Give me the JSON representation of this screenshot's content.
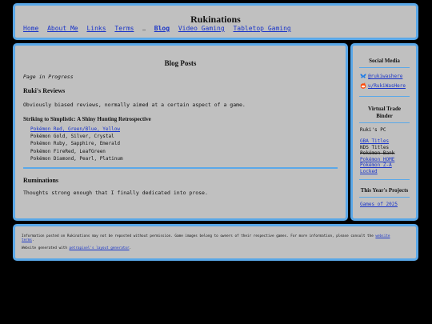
{
  "header": {
    "title": "Rukinations",
    "nav": [
      {
        "label": "Home"
      },
      {
        "label": "About Me"
      },
      {
        "label": "Links"
      },
      {
        "label": "Terms"
      },
      {
        "label": "Blog"
      },
      {
        "label": "Video Gaming"
      },
      {
        "label": "Tabletop Gaming"
      }
    ],
    "separator": "…"
  },
  "main": {
    "title": "Blog Posts",
    "progress_note": "Page in Progress",
    "section1": {
      "heading": "Ruki's Reviews",
      "description": "Obviously biased reviews, normally aimed at a certain aspect of a game.",
      "subheading": "Striking to Simplistic: A Shiny Hunting Retrospective",
      "games": [
        "Pokémon Red, Green/Blue, Yellow",
        "Pokémon Gold, Silver, Crystal",
        "Pokémon Ruby, Sapphire, Emerald",
        "Pokémon FireRed, LeafGreen",
        "Pokémon Diamond, Pearl, Platinum"
      ]
    },
    "section2": {
      "heading": "Ruminations",
      "description": "Thoughts strong enough that I finally dedicated into prose."
    }
  },
  "sidebar": {
    "social": {
      "heading": "Social Media",
      "bluesky": "@rukiwashere",
      "reddit": "u/RukiWasHere"
    },
    "binder": {
      "heading_line1": "Virtual Trade",
      "heading_line2": "Binder",
      "subheading": "Ruki's PC",
      "items": [
        {
          "label": "GBA Titles"
        },
        {
          "label": "NDS Titles"
        },
        {
          "label": "Pokémon Bank"
        },
        {
          "label": "Pokémon HOME"
        },
        {
          "label": "Pokémon Z-A"
        },
        {
          "label": "Locked"
        }
      ]
    },
    "projects": {
      "heading": "This Year's Projects",
      "link": "Games of 2025"
    }
  },
  "footer": {
    "line1_text": "Information posted on Rukinations may not be reposted without permission. Game images belong to owners of their respective games. For more information, please consult the",
    "line1_link_a": "website",
    "line1_link_b": "terms",
    "line1_end": ".",
    "line2_text": "Website generated with",
    "line2_link": "petrapixel's layout generator",
    "line2_end": "."
  }
}
